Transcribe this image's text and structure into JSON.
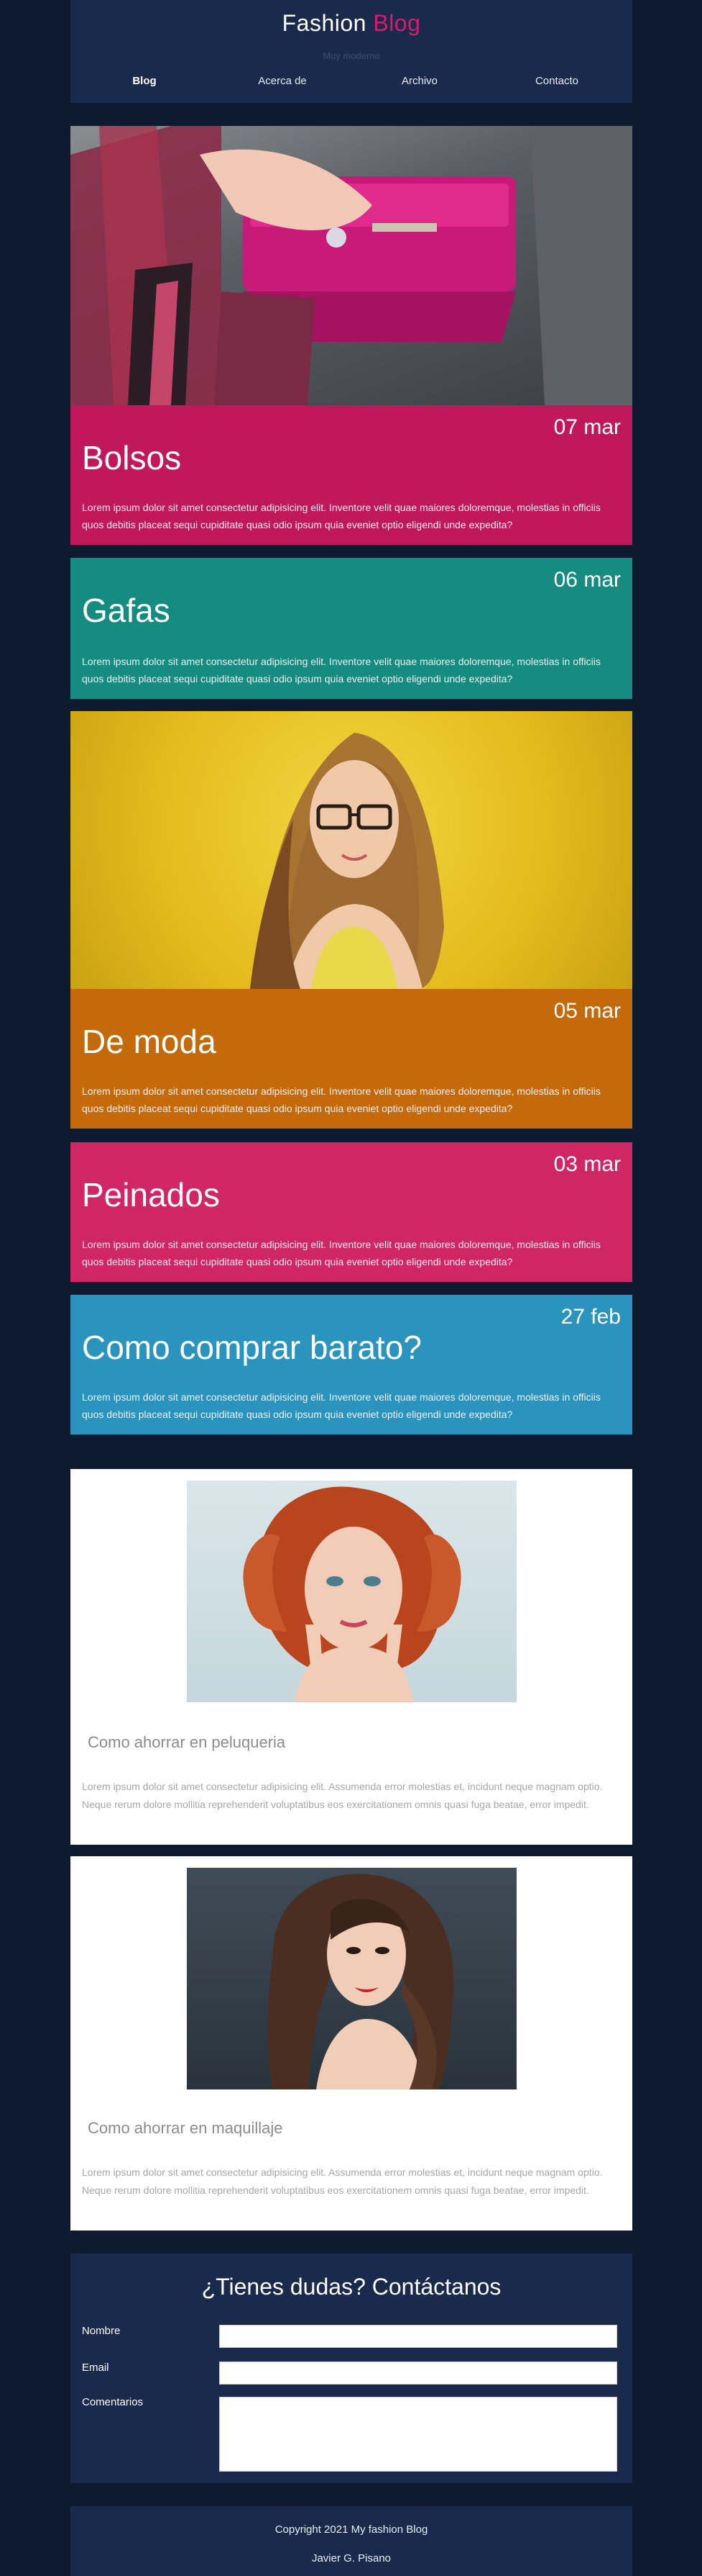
{
  "header": {
    "brand_part1": "Fashion",
    "brand_part2": "Blog",
    "tagline": "Muy moderno",
    "nav": [
      "Blog",
      "Acerca de",
      "Archivo",
      "Contacto"
    ]
  },
  "posts": [
    {
      "date": "07 mar",
      "title": "Bolsos",
      "text": "Lorem ipsum dolor sit amet consectetur adipisicing elit. Inventore velit quae maiores doloremque, molestias in officiis quos debitis placeat sequi cupiditate quasi odio ipsum quia eveniet optio eligendi unde expedita?",
      "color": "#c0185a"
    },
    {
      "date": "06 mar",
      "title": "Gafas",
      "text": "Lorem ipsum dolor sit amet consectetur adipisicing elit. Inventore velit quae maiores doloremque, molestias in officiis quos debitis placeat sequi cupiditate quasi odio ipsum quia eveniet optio eligendi unde expedita?",
      "color": "#168b7f"
    },
    {
      "date": "05 mar",
      "title": "De moda",
      "text": "Lorem ipsum dolor sit amet consectetur adipisicing elit. Inventore velit quae maiores doloremque, molestias in officiis quos debitis placeat sequi cupiditate quasi odio ipsum quia eveniet optio eligendi unde expedita?",
      "color": "#c46a0a"
    },
    {
      "date": "03 mar",
      "title": "Peinados",
      "text": "Lorem ipsum dolor sit amet consectetur adipisicing elit. Inventore velit quae maiores doloremque, molestias in officiis quos debitis placeat sequi cupiditate quasi odio ipsum quia eveniet optio eligendi unde expedita?",
      "color": "#d12664"
    },
    {
      "date": "27 feb",
      "title": "Como comprar barato?",
      "text": "Lorem ipsum dolor sit amet consectetur adipisicing elit. Inventore velit quae maiores doloremque, molestias in officiis quos debitis placeat sequi cupiditate quasi odio ipsum quia eveniet optio eligendi unde expedita?",
      "color": "#2a94bf"
    }
  ],
  "cards": [
    {
      "title": "Como ahorrar en peluqueria",
      "text": "Lorem ipsum dolor sit amet consectetur adipisicing elit. Assumenda error molestias et, incidunt neque magnam optio. Neque rerum dolore mollitia reprehenderit voluptatibus eos exercitationem omnis quasi fuga beatae, error impedit."
    },
    {
      "title": "Como ahorrar en maquillaje",
      "text": "Lorem ipsum dolor sit amet consectetur adipisicing elit. Assumenda error molestias et, incidunt neque magnam optio. Neque rerum dolore mollitia reprehenderit voluptatibus eos exercitationem omnis quasi fuga beatae, error impedit."
    }
  ],
  "contact": {
    "heading": "¿Tienes dudas? Contáctanos",
    "name_label": "Nombre",
    "email_label": "Email",
    "comments_label": "Comentarios"
  },
  "footer": {
    "copyright": "Copyright 2021 My fashion Blog",
    "author": "Javier G. Pisano"
  }
}
